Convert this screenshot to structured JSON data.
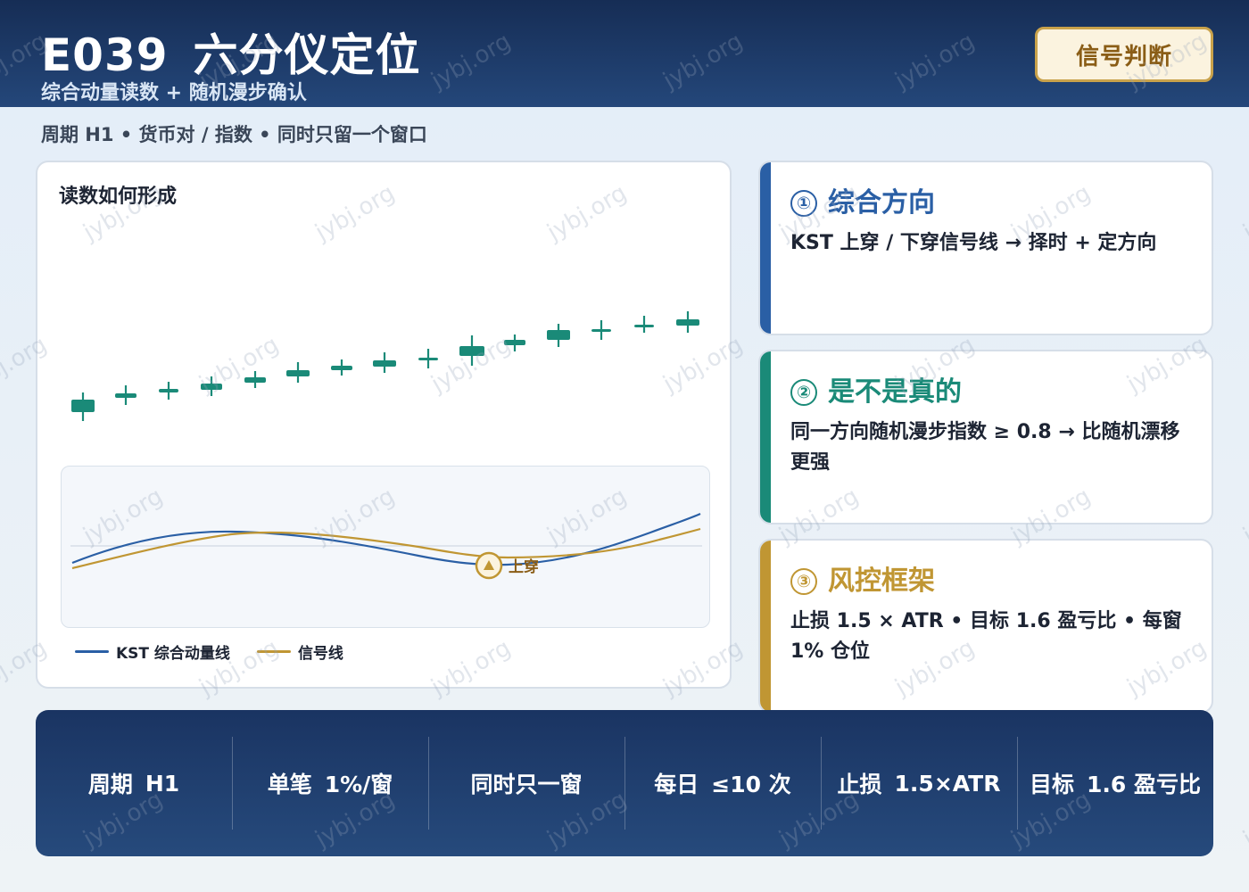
{
  "header": {
    "code": "E039",
    "title": "六分仪定位",
    "subtitle": "综合动量读数 + 随机漫步确认",
    "meta": "周期 H1 • 货币对 / 指数 • 同时只留一个窗口",
    "badge": "信号判断"
  },
  "chart_panel": {
    "title": "读数如何形成",
    "cross_label": "上穿",
    "legend": [
      {
        "name": "KST 综合动量线",
        "color": "#2a5fa5"
      },
      {
        "name": "信号线",
        "color": "#c09633"
      }
    ]
  },
  "cards": [
    {
      "num": "①",
      "title": "综合方向",
      "body": "KST 上穿 / 下穿信号线 → 择时 + 定方向",
      "color": "#2a5fa5"
    },
    {
      "num": "②",
      "title": "是不是真的",
      "body": "同一方向随机漫步指数 ≥ 0.8 → 比随机漂移更强",
      "color": "#1a8a78"
    },
    {
      "num": "③",
      "title": "风控框架",
      "body": "止损 1.5 × ATR • 目标 1.6 盈亏比 • 每窗 1% 仓位",
      "color": "#c09633"
    }
  ],
  "stats": [
    {
      "label": "周期",
      "value": "H1"
    },
    {
      "label": "单笔",
      "value": "1%/窗"
    },
    {
      "label": "",
      "value": "同时只一窗"
    },
    {
      "label": "每日",
      "value": "≤10 次"
    },
    {
      "label": "止损",
      "value": "1.5×ATR"
    },
    {
      "label": "目标",
      "value": "1.6 盈亏比"
    }
  ],
  "watermark": "jybj.org",
  "colors": {
    "candle": "#1a8a78",
    "kst": "#2a5fa5",
    "signal": "#c09633",
    "header": "#1a3462"
  }
}
